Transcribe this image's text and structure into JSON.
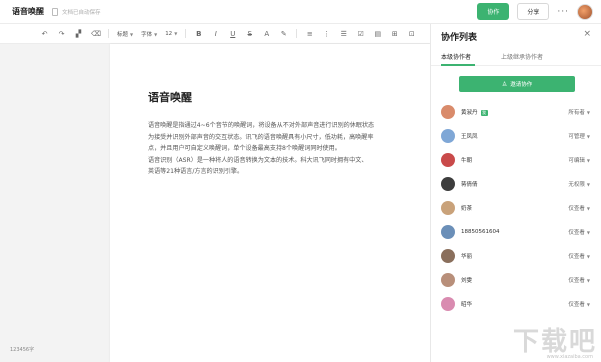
{
  "topbar": {
    "doc_title": "语音唤醒",
    "save_status": "文档已自动保存",
    "collab_label": "协作",
    "share_label": "分享",
    "more_label": "···"
  },
  "toolbar": {
    "heading_label": "标题",
    "font_label": "字体",
    "size_label": "12"
  },
  "document": {
    "heading": "语音唤醒",
    "lines": [
      "语音唤醒是指通过4~6个音节的唤醒词，将设备从不对外部声音进行识别的休眠状态",
      "为接受并识别外部声音的交互状态。讯飞的语音唤醒具有小尺寸，低功耗，高唤醒率",
      "点，并且用户可自定义唤醒词，单个设备最高支持8个唤醒词同时使用。",
      "语音识别（ASR）是一种将人的语音转换为文本的技术。科大讯飞同时拥有中文、",
      "英语等21种语言/方言的识别引擎。"
    ]
  },
  "word_count": "123456字",
  "panel": {
    "title": "协作列表",
    "close_label": "×",
    "tab_current": "本级协作者",
    "tab_parent": "上级继承协作者",
    "invite_label": "邀请协作",
    "collaborators": [
      {
        "name": "黄淑丹",
        "badge": "我",
        "role": "所有者",
        "color": "#d98b6b"
      },
      {
        "name": "王凤凤",
        "role": "可管理",
        "color": "#7fa7d6"
      },
      {
        "name": "牛朝",
        "role": "可编辑",
        "color": "#c94a4a"
      },
      {
        "name": "蒋倩倩",
        "role": "无权限",
        "color": "#3d3d3d"
      },
      {
        "name": "奶茶",
        "role": "仅查看",
        "color": "#c9a27a"
      },
      {
        "name": "18850561604",
        "role": "仅查看",
        "color": "#6b8fb8"
      },
      {
        "name": "华丽",
        "role": "仅查看",
        "color": "#8a6f5c"
      },
      {
        "name": "刘雯",
        "role": "仅查看",
        "color": "#b88f7a"
      },
      {
        "name": "昭华",
        "role": "仅查看",
        "color": "#d98bb0"
      }
    ]
  },
  "watermark": {
    "text": "下载吧",
    "url": "www.xiazaiba.com"
  }
}
